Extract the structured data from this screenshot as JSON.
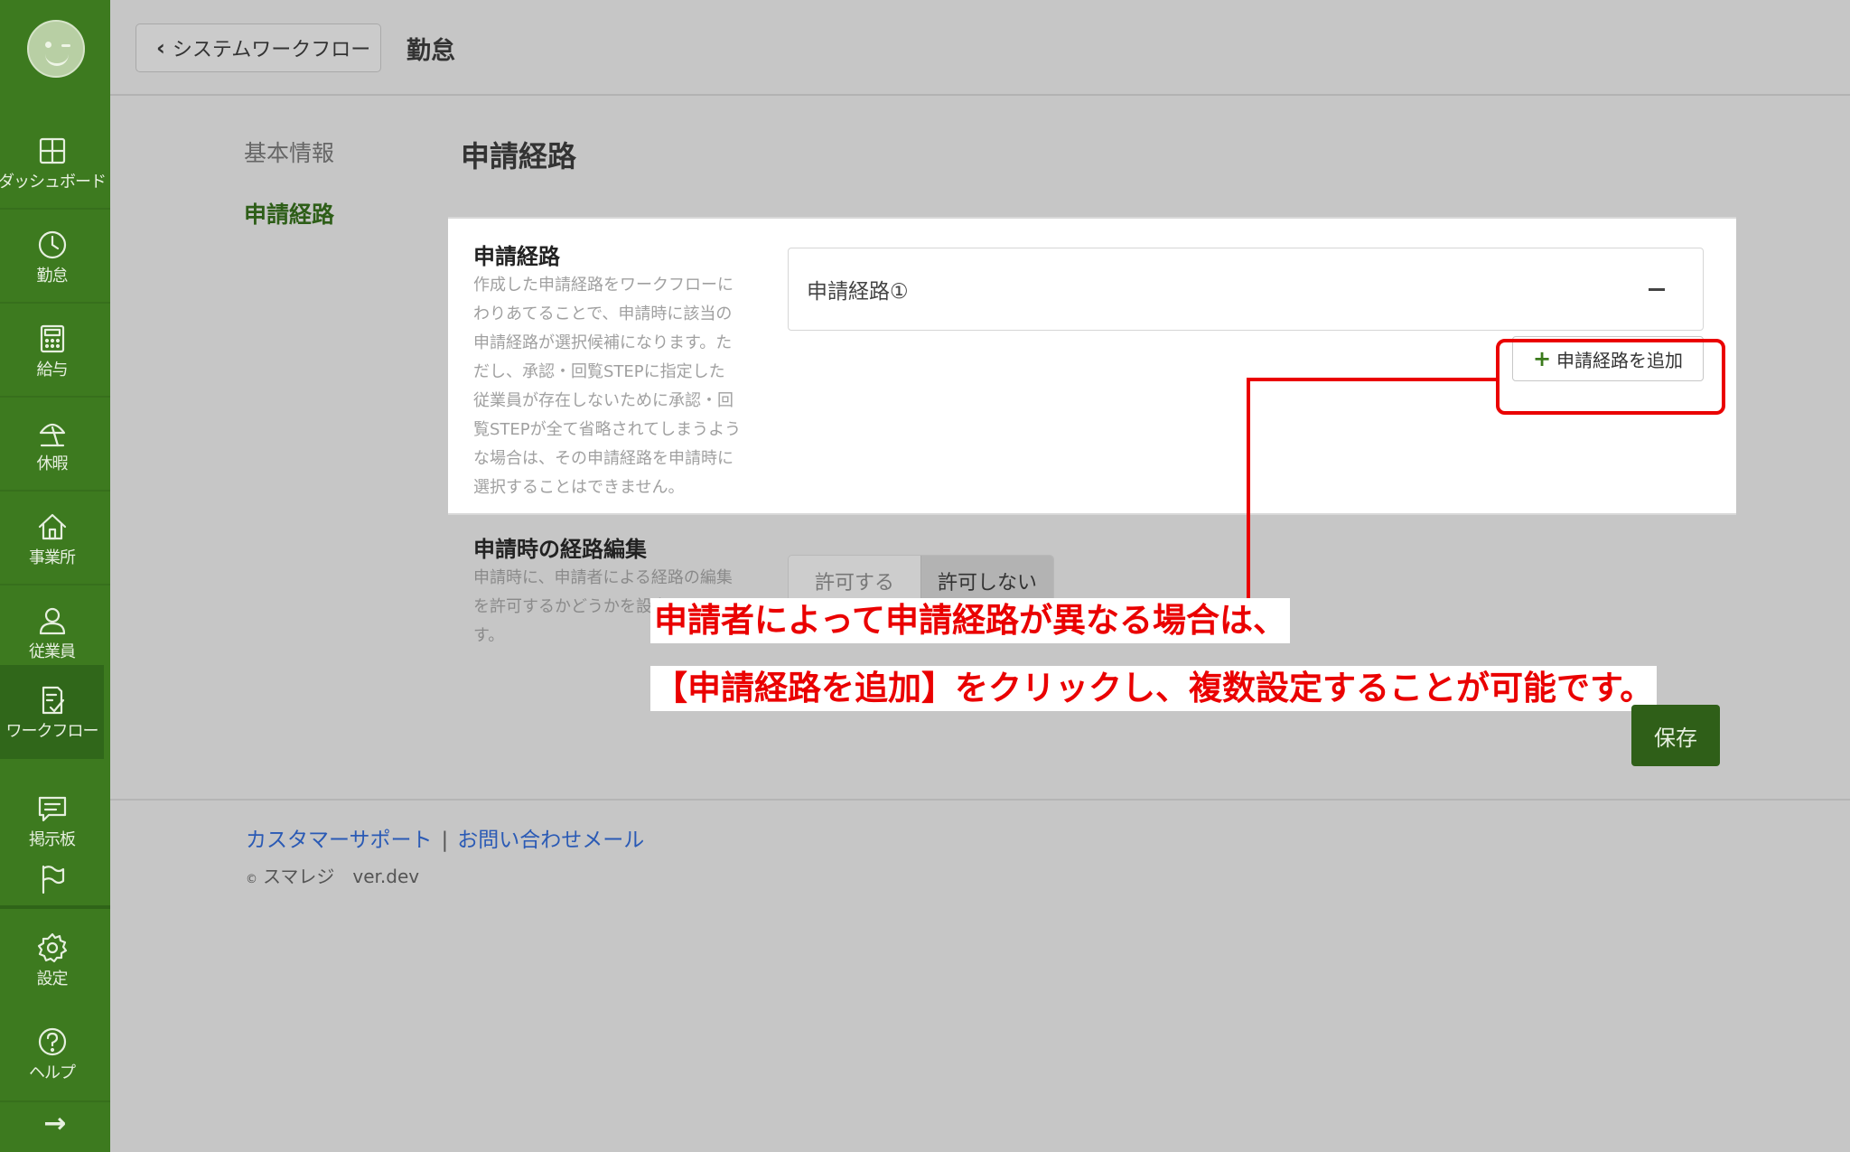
{
  "sidebar": {
    "items": [
      {
        "label": "ダッシュボード",
        "icon": "dashboard-icon"
      },
      {
        "label": "勤怠",
        "icon": "clock-icon"
      },
      {
        "label": "給与",
        "icon": "calculator-icon"
      },
      {
        "label": "休暇",
        "icon": "parasol-icon"
      },
      {
        "label": "事業所",
        "icon": "home-icon"
      },
      {
        "label": "従業員",
        "icon": "person-icon"
      },
      {
        "label": "ワークフロー",
        "icon": "checklist-icon"
      },
      {
        "label": "掲示板",
        "icon": "chat-icon"
      },
      {
        "label": "",
        "icon": "flag-icon"
      },
      {
        "label": "設定",
        "icon": "gear-icon"
      },
      {
        "label": "ヘルプ",
        "icon": "help-icon"
      }
    ],
    "active_item": "ワークフロー",
    "expand_arrow": "→"
  },
  "header": {
    "back_label": "システムワークフロー",
    "title": "勤怠"
  },
  "subnav": {
    "items": [
      "基本情報",
      "申請経路"
    ],
    "active": "申請経路"
  },
  "main": {
    "section_title": "申請経路",
    "route_row": {
      "label": "申請経路",
      "description": [
        "作成した申請経路をワークフローに",
        "わりあてることで、申請時に該当の",
        "申請経路が選択候補になります。た",
        "だし、承認・回覧STEPに指定した",
        "従業員が存在しないために承認・回",
        "覧STEPが全て省略されてしまうよう",
        "な場合は、その申請経路を申請時に",
        "選択することはできません。"
      ],
      "route_name": "申請経路①",
      "add_button": "申請経路を追加"
    },
    "edit_row": {
      "label": "申請時の経路編集",
      "description": [
        "申請時に、申請者による経路の編集",
        "を許可するかどうかを設定しま",
        "す。"
      ],
      "options": [
        "許可する",
        "許可しない"
      ],
      "selected": "許可しない"
    },
    "save_button": "保存"
  },
  "annotation": {
    "line1": "申請者によって申請経路が異なる場合は、",
    "line2": "【申請経路を追加】をクリックし、複数設定することが可能です。"
  },
  "footer": {
    "link1": "カスタマーサポート",
    "separator": "|",
    "link2": "お問い合わせメール",
    "copyright_symbol": "©",
    "copyright": "スマレジ　ver.dev"
  },
  "colors": {
    "sidebar": "#3d7a1f",
    "accent": "#2f5f18",
    "annotation": "#ea0000",
    "link": "#2a5ab5"
  }
}
